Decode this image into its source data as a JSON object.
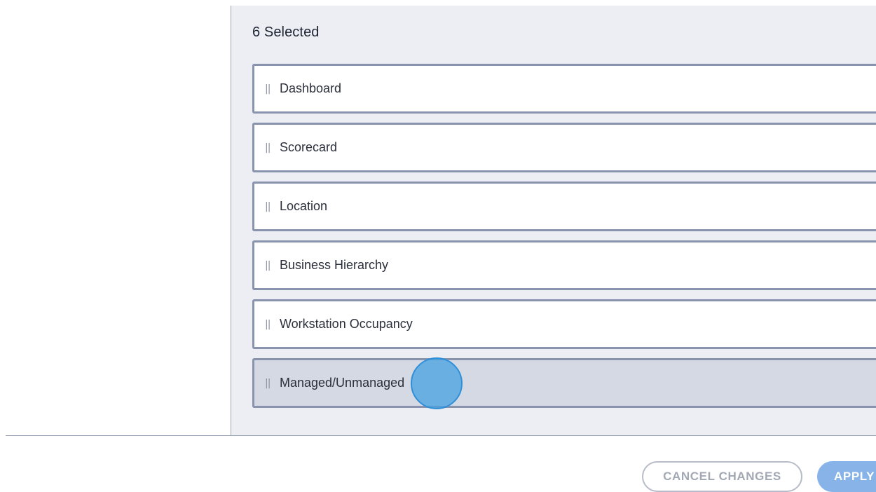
{
  "selection": {
    "count_label": "6 Selected"
  },
  "items": [
    {
      "label": "Dashboard"
    },
    {
      "label": "Scorecard"
    },
    {
      "label": "Location"
    },
    {
      "label": "Business Hierarchy"
    },
    {
      "label": "Workstation Occupancy"
    },
    {
      "label": "Managed/Unmanaged"
    }
  ],
  "handle_glyph": "||",
  "footer": {
    "cancel_label": "CANCEL CHANGES",
    "apply_label": "APPLY"
  },
  "colors": {
    "accent": "#87b3e8",
    "item_border": "#8a93ad",
    "panel_background": "#eceef3",
    "dragging_item": "#d5d9e3"
  },
  "icons": {
    "drag_handle": "drag-handle-icon"
  }
}
